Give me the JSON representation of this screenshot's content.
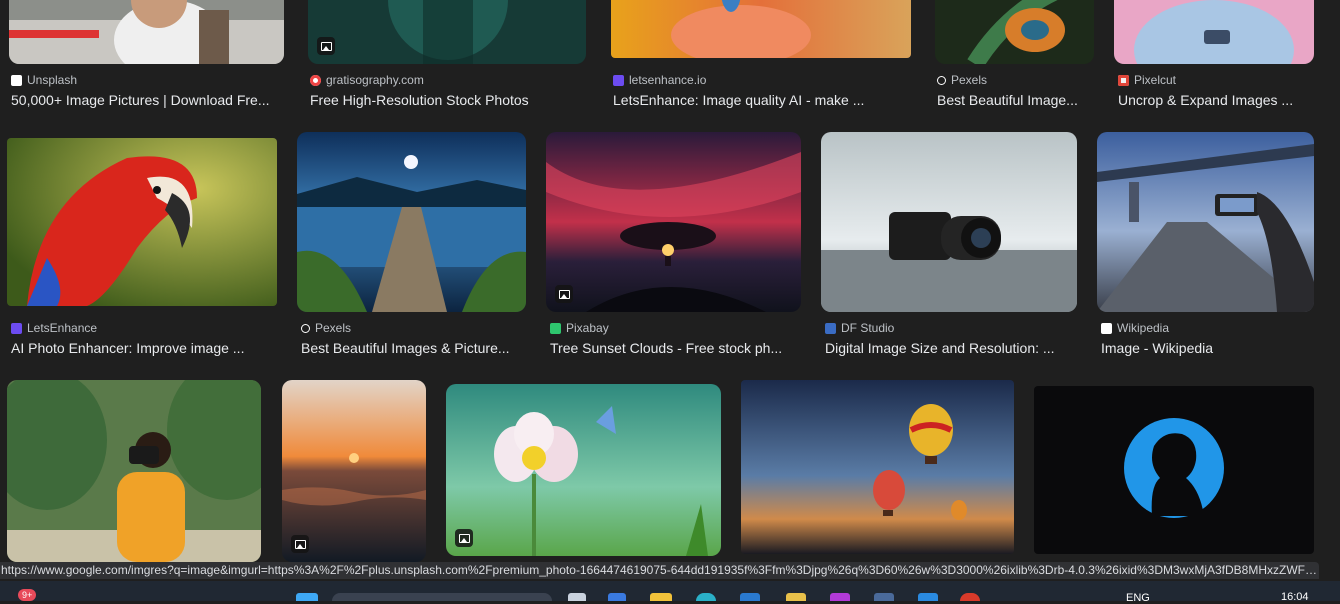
{
  "results": [
    {
      "source": "Unsplash",
      "title": "50,000+ Image Pictures | Download Fre..."
    },
    {
      "source": "gratisography.com",
      "title": "Free High-Resolution Stock Photos"
    },
    {
      "source": "letsenhance.io",
      "title": "LetsEnhance: Image quality AI - make ..."
    },
    {
      "source": "Pexels",
      "title": "Best Beautiful Image..."
    },
    {
      "source": "Pixelcut",
      "title": "Uncrop & Expand Images ..."
    },
    {
      "source": "LetsEnhance",
      "title": "AI Photo Enhancer: Improve image ..."
    },
    {
      "source": "Pexels",
      "title": "Best Beautiful Images & Picture..."
    },
    {
      "source": "Pixabay",
      "title": "Tree Sunset Clouds - Free stock ph..."
    },
    {
      "source": "DF Studio",
      "title": "Digital Image Size and Resolution: ..."
    },
    {
      "source": "Wikipedia",
      "title": "Image - Wikipedia"
    }
  ],
  "status_url": "https://www.google.com/imgres?q=image&imgurl=https%3A%2F%2Fplus.unsplash.com%2Fpremium_photo-1664474619075-644dd191935f%3Ffm%3Djpg%26q%3D60%26w%3D3000%26ixlib%3Drb-4.0.3%26ixid%3DM3wxMjA3fDB8MHxzZWFyY2h...",
  "taskbar": {
    "notification_badge": "9+",
    "language": "ENG",
    "clock": "16:04"
  },
  "colors": {
    "background": "#1f1f1f",
    "title_text": "#e8eaed",
    "source_text": "#bdc1c6",
    "taskbar": "#202833"
  }
}
